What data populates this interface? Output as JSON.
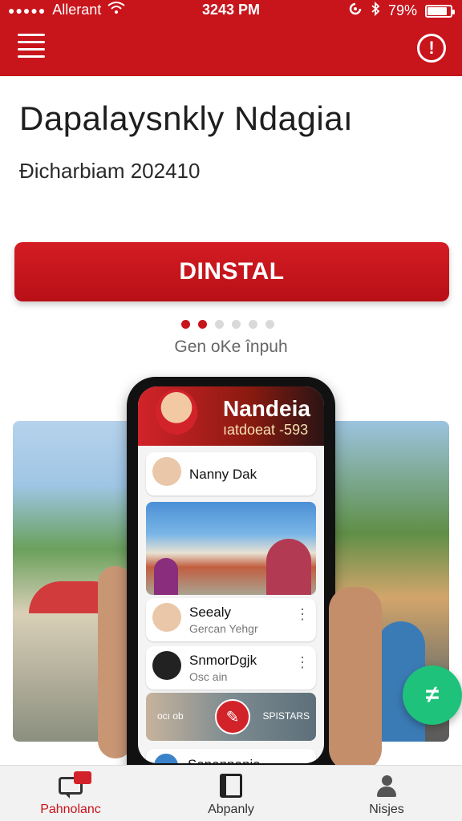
{
  "status_bar": {
    "signal_dots": "●●●●●",
    "carrier": "Allerant",
    "time": "3243 PM",
    "battery": "79%",
    "battery_level": 0.79
  },
  "app_bar": {
    "menu_icon": "hamburger-menu-icon",
    "alert_icon": "exclamation-circle-icon",
    "alert_glyph": "!"
  },
  "header": {
    "title": "Dapalaysnkly Ndagiaı",
    "subtitle": "Ðicharbiam 202410"
  },
  "install_button": {
    "label": "DINSTAL"
  },
  "pager": {
    "count": 6,
    "active": [
      0,
      1
    ]
  },
  "hint": {
    "text": "Gen oKe înpuh"
  },
  "phone_preview": {
    "header_title": "Nandeia",
    "header_subtitle": "ıatdoeat -593",
    "cards": [
      {
        "name": "Nanny Dak",
        "subtitle": ""
      },
      {
        "name": "Seealy",
        "subtitle": "Gercan Yehgr"
      },
      {
        "name": "SnmorDgjk",
        "subtitle": "Osc ain"
      }
    ],
    "video": {
      "label_left": "ocı ob",
      "label_right": "SPISTARS"
    },
    "next_card": {
      "name": "Sanannania"
    }
  },
  "fab": {
    "icon": "edit-check-icon",
    "glyph": "≠"
  },
  "bottom_nav": [
    {
      "label": "Pahnolanc",
      "icon": "chat-icon",
      "active": true
    },
    {
      "label": "Abpanly",
      "icon": "book-icon",
      "active": false
    },
    {
      "label": "Nisjes",
      "icon": "user-icon",
      "active": false
    }
  ],
  "colors": {
    "brand_red": "#c8141b",
    "fab_green": "#1ec27a"
  }
}
